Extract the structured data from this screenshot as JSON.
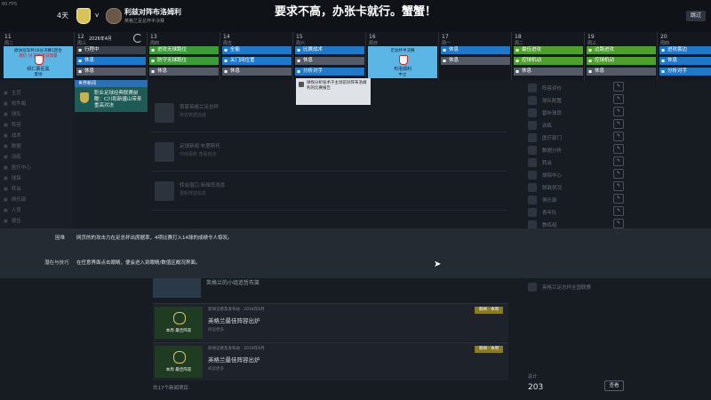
{
  "meta": {
    "fps": "60 FPS"
  },
  "header": {
    "days": "4天",
    "vs": "v",
    "fixture_title": "利兹对阵布洛姆利",
    "fixture_sub": "英格兰足总杯半决赛",
    "headline": "要求不高，办张卡就行。蟹蟹！",
    "skip_label": "跳过"
  },
  "calendar": {
    "month": "2026年4月",
    "days": [
      {
        "num": "11",
        "wd": "周二",
        "card": true,
        "card_top": "欧洲冠军杯16分决赛1回合",
        "card_mid": "我们 对 巴黎圣日耳曼",
        "card_team": "拜仁慕尼黑",
        "card_loc": "客场"
      },
      {
        "num": "12",
        "wd": "周三",
        "events": [
          [
            "dark",
            "行程中"
          ],
          [
            "blue",
            "休息"
          ],
          [
            "gray",
            "休息"
          ]
        ]
      },
      {
        "num": "13",
        "wd": "周四",
        "events": [
          [
            "green",
            "进攻无球跑位"
          ],
          [
            "green",
            "防守无球跑位"
          ],
          [
            "gray",
            "休息"
          ]
        ]
      },
      {
        "num": "14",
        "wd": "周五",
        "events": [
          [
            "blue",
            "全能"
          ],
          [
            "blue",
            "关门间位置"
          ],
          [
            "gray",
            "休息"
          ]
        ]
      },
      {
        "num": "15",
        "wd": "周六",
        "events": [
          [
            "blue",
            "比赛战术"
          ],
          [
            "gray",
            "休息"
          ],
          [
            "blue",
            "分析对手"
          ]
        ]
      },
      {
        "num": "16",
        "wd": "周日",
        "card": true,
        "card_top": "足总杯半决赛",
        "card_mid": "",
        "card_team": "布洛姆利",
        "card_loc": "中立"
      },
      {
        "num": "17",
        "wd": "周一",
        "events": [
          [
            "blue",
            "休息"
          ],
          [
            "gray",
            "休息"
          ]
        ]
      },
      {
        "num": "18",
        "wd": "周二",
        "events": [
          [
            "lime",
            "最佳进攻"
          ],
          [
            "lime",
            "控球机动"
          ],
          [
            "gray",
            "休息"
          ]
        ]
      },
      {
        "num": "19",
        "wd": "周三",
        "events": [
          [
            "lime",
            "边路进攻"
          ],
          [
            "lime",
            "控球机动"
          ],
          [
            "gray",
            "休息"
          ]
        ]
      },
      {
        "num": "20",
        "wd": "周四",
        "events": [
          [
            "blue",
            "进攻套边"
          ],
          [
            "blue",
            "休息"
          ],
          [
            "blue",
            "分析对手"
          ]
        ]
      }
    ]
  },
  "sidebar": [
    "主页",
    "收件箱",
    "球队",
    "阵容",
    "战术",
    "数据",
    "训练",
    "医疗中心",
    "球探",
    "转会",
    "俱乐部",
    "人员",
    "报告"
  ],
  "event_card": {
    "head": "世界新闻",
    "body": "职业足球经典联赛前瞻：C川和新疆山带来重高对决"
  },
  "tooltip": {
    "text": "球探分析技术于主场前对阵布洛姆利的比赛报告"
  },
  "feed": [
    {
      "t1": "首家英格兰足总杯",
      "t2": "阵容数据完成"
    },
    {
      "t1": "足球新闻 布里斯托",
      "t2": "内线更新 查看信息"
    },
    {
      "t1": "转会窗口 新球员消息",
      "t2": "更新阵容信息"
    }
  ],
  "right_panel": [
    "阵容评价",
    "球队配置",
    "替补球员",
    "训练",
    "医疗部门",
    "数据分析",
    "转会",
    "球探中心",
    "财政状况",
    "俱乐部",
    "青年队",
    "教练组"
  ],
  "overlay": {
    "label1": "困难",
    "value1": "网页的的攻击力在足总杯出席据率，4项比赛打入14球的成绩令人惊叹。",
    "label2": "潜在与技巧",
    "value2": "在任意界面点击眼睛，便会进入到眼睛/数值区概况界面。"
  },
  "news_first": {
    "title": "英格兰的小组追哲布莱"
  },
  "news": [
    {
      "src": "新闻记者及发布站 · 2018年8月",
      "title": "英格兰最佳阵容出炉",
      "sub": "阅读更多",
      "cap1": "本周",
      "cap2": "最佳阵容",
      "tag": "新闻 · 本周"
    },
    {
      "src": "新闻记者及发布站 · 2018年8月",
      "title": "英格兰最佳阵容出炉",
      "sub": "阅读更多",
      "cap1": "本周",
      "cap2": "最佳阵容",
      "tag": "新闻 · 本周"
    }
  ],
  "news_count": "共17个新闻项目",
  "right_bottom": {
    "item": "英格兰足总杯全国联赛",
    "total_label": "总计",
    "total": "203",
    "view_btn": "查看"
  },
  "colors": {
    "accent_blue": "#1f78c8",
    "accent_green": "#3d9b3a",
    "card_sky": "#5bb6e6"
  }
}
